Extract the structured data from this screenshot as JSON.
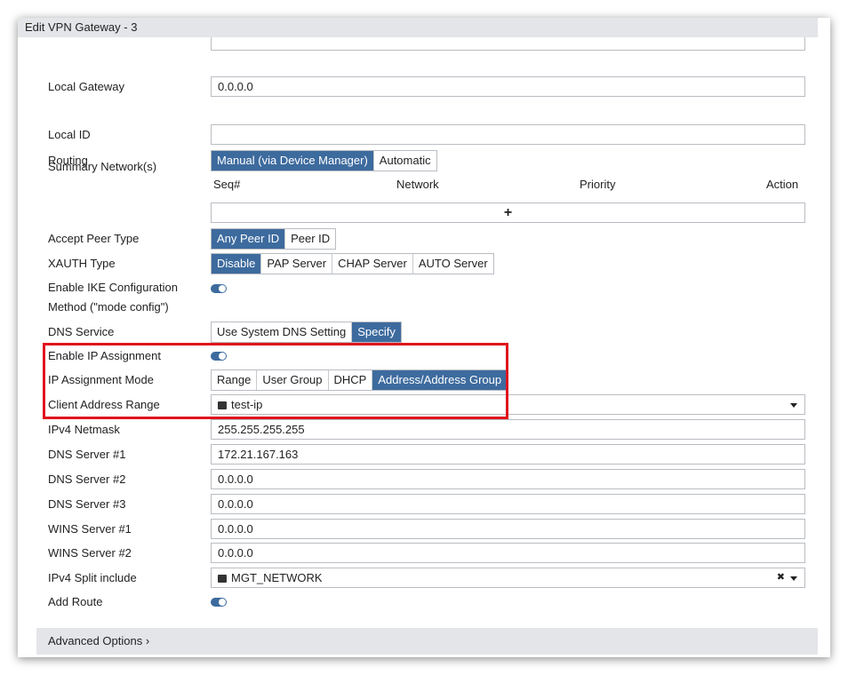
{
  "title": "Edit VPN Gateway - 3",
  "fields": {
    "local_gateway": {
      "label": "Local Gateway",
      "value": "0.0.0.0"
    },
    "local_id": {
      "label": "Local ID",
      "value": ""
    },
    "routing": {
      "label": "Routing",
      "options": [
        "Manual (via Device Manager)",
        "Automatic"
      ],
      "selected": 0
    },
    "summary": {
      "label": "Summary Network(s)",
      "columns": [
        "Seq#",
        "Network",
        "Priority",
        "Action"
      ],
      "add": "+"
    },
    "accept_peer": {
      "label": "Accept Peer Type",
      "options": [
        "Any Peer ID",
        "Peer ID"
      ],
      "selected": 0
    },
    "xauth": {
      "label": "XAUTH Type",
      "options": [
        "Disable",
        "PAP Server",
        "CHAP Server",
        "AUTO Server"
      ],
      "selected": 0
    },
    "ike": {
      "label1": "Enable IKE Configuration",
      "label2": "Method (\"mode config\")",
      "enabled": true
    },
    "dns_service": {
      "label": "DNS Service",
      "options": [
        "Use System DNS Setting",
        "Specify"
      ],
      "selected": 1
    },
    "ip_assign": {
      "label": "Enable IP Assignment",
      "enabled": true
    },
    "ip_mode": {
      "label": "IP Assignment Mode",
      "options": [
        "Range",
        "User Group",
        "DHCP",
        "Address/Address Group"
      ],
      "selected": 3
    },
    "client_range": {
      "label": "Client Address Range",
      "value": "test-ip"
    },
    "netmask": {
      "label": "IPv4 Netmask",
      "value": "255.255.255.255"
    },
    "dns1": {
      "label": "DNS Server #1",
      "value": "172.21.167.163"
    },
    "dns2": {
      "label": "DNS Server #2",
      "value": "0.0.0.0"
    },
    "dns3": {
      "label": "DNS Server #3",
      "value": "0.0.0.0"
    },
    "wins1": {
      "label": "WINS Server #1",
      "value": "0.0.0.0"
    },
    "wins2": {
      "label": "WINS Server #2",
      "value": "0.0.0.0"
    },
    "split": {
      "label": "IPv4 Split include",
      "value": "MGT_NETWORK"
    },
    "add_route": {
      "label": "Add Route",
      "enabled": true
    }
  },
  "advanced": "Advanced Options",
  "colors": {
    "accent": "#3d6b9e",
    "highlight": "#e0141e"
  }
}
